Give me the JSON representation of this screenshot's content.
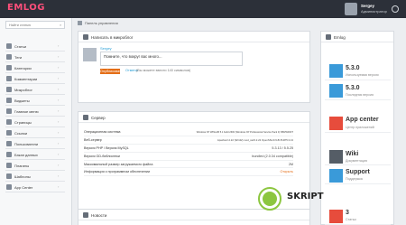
{
  "app": {
    "logo": "EMLOG"
  },
  "user": {
    "name": "Sergey",
    "role": "Администратор"
  },
  "search": {
    "placeholder": "Найти статью"
  },
  "sidebar": {
    "items": [
      {
        "label": "Статьи"
      },
      {
        "label": "Теги"
      },
      {
        "label": "Категории"
      },
      {
        "label": "Комментарии"
      },
      {
        "label": "Микроблог"
      },
      {
        "label": "Виджеты"
      },
      {
        "label": "Главное меню"
      },
      {
        "label": "Страницы"
      },
      {
        "label": "Ссылки"
      },
      {
        "label": "Пользователи"
      },
      {
        "label": "Бэкап данных"
      },
      {
        "label": "Плагины"
      },
      {
        "label": "Шаблоны"
      },
      {
        "label": "App Center"
      }
    ]
  },
  "breadcrumb": {
    "label": "Панель управления"
  },
  "microblog": {
    "title": "Написать в микроблог",
    "user": "Sergey",
    "text": "Помните, что вокруг вас много...",
    "post_label": "Опубликовать",
    "cancel_label": "Отмена",
    "hint": "(Вы можете ввести 140 символов)"
  },
  "server": {
    "title": "Сервер",
    "rows": [
      {
        "label": "Операционная система",
        "value": "Windows NT WINLAB 5.1 build 2600 (Windows XP Professional Service Pack 3) i586/WINNT"
      },
      {
        "label": "Веб-сервер",
        "value": "Apache/2.2.22 (Win32) mod_ssl/2.2.22 OpenSSL/0.9.8t PHP/5.3.13"
      },
      {
        "label": "Версия PHP / Версия MySQL",
        "value": "5.3.13 / 5.5.25"
      },
      {
        "label": "Версия GD-библиотеки",
        "value": "bundled (2.0.34 compatible)"
      },
      {
        "label": "Максимальный размер загружаемого файла",
        "value": "2M"
      },
      {
        "label": "Информация о программном обеспечении",
        "value": "Открыть"
      }
    ]
  },
  "news": {
    "title": "Новости"
  },
  "right": {
    "title": "Emlog",
    "tiles": [
      {
        "big": "5.3.0",
        "small": "Используемая версия",
        "color": "#3a9ad9"
      },
      {
        "big": "5.3.0",
        "small": "Последняя версия",
        "color": "#3a9ad9"
      },
      {
        "big": "App center",
        "small": "Центр приложений",
        "color": "#e74c3c"
      },
      {
        "big": "Wiki",
        "small": "Документация",
        "color": "#555d66"
      },
      {
        "big": "Support",
        "small": "Поддержка",
        "color": "#3a9ad9"
      },
      {
        "big": "3",
        "small": "Статьи",
        "color": "#e74c3c"
      }
    ]
  },
  "watermark": {
    "text": "SKRIPT"
  }
}
